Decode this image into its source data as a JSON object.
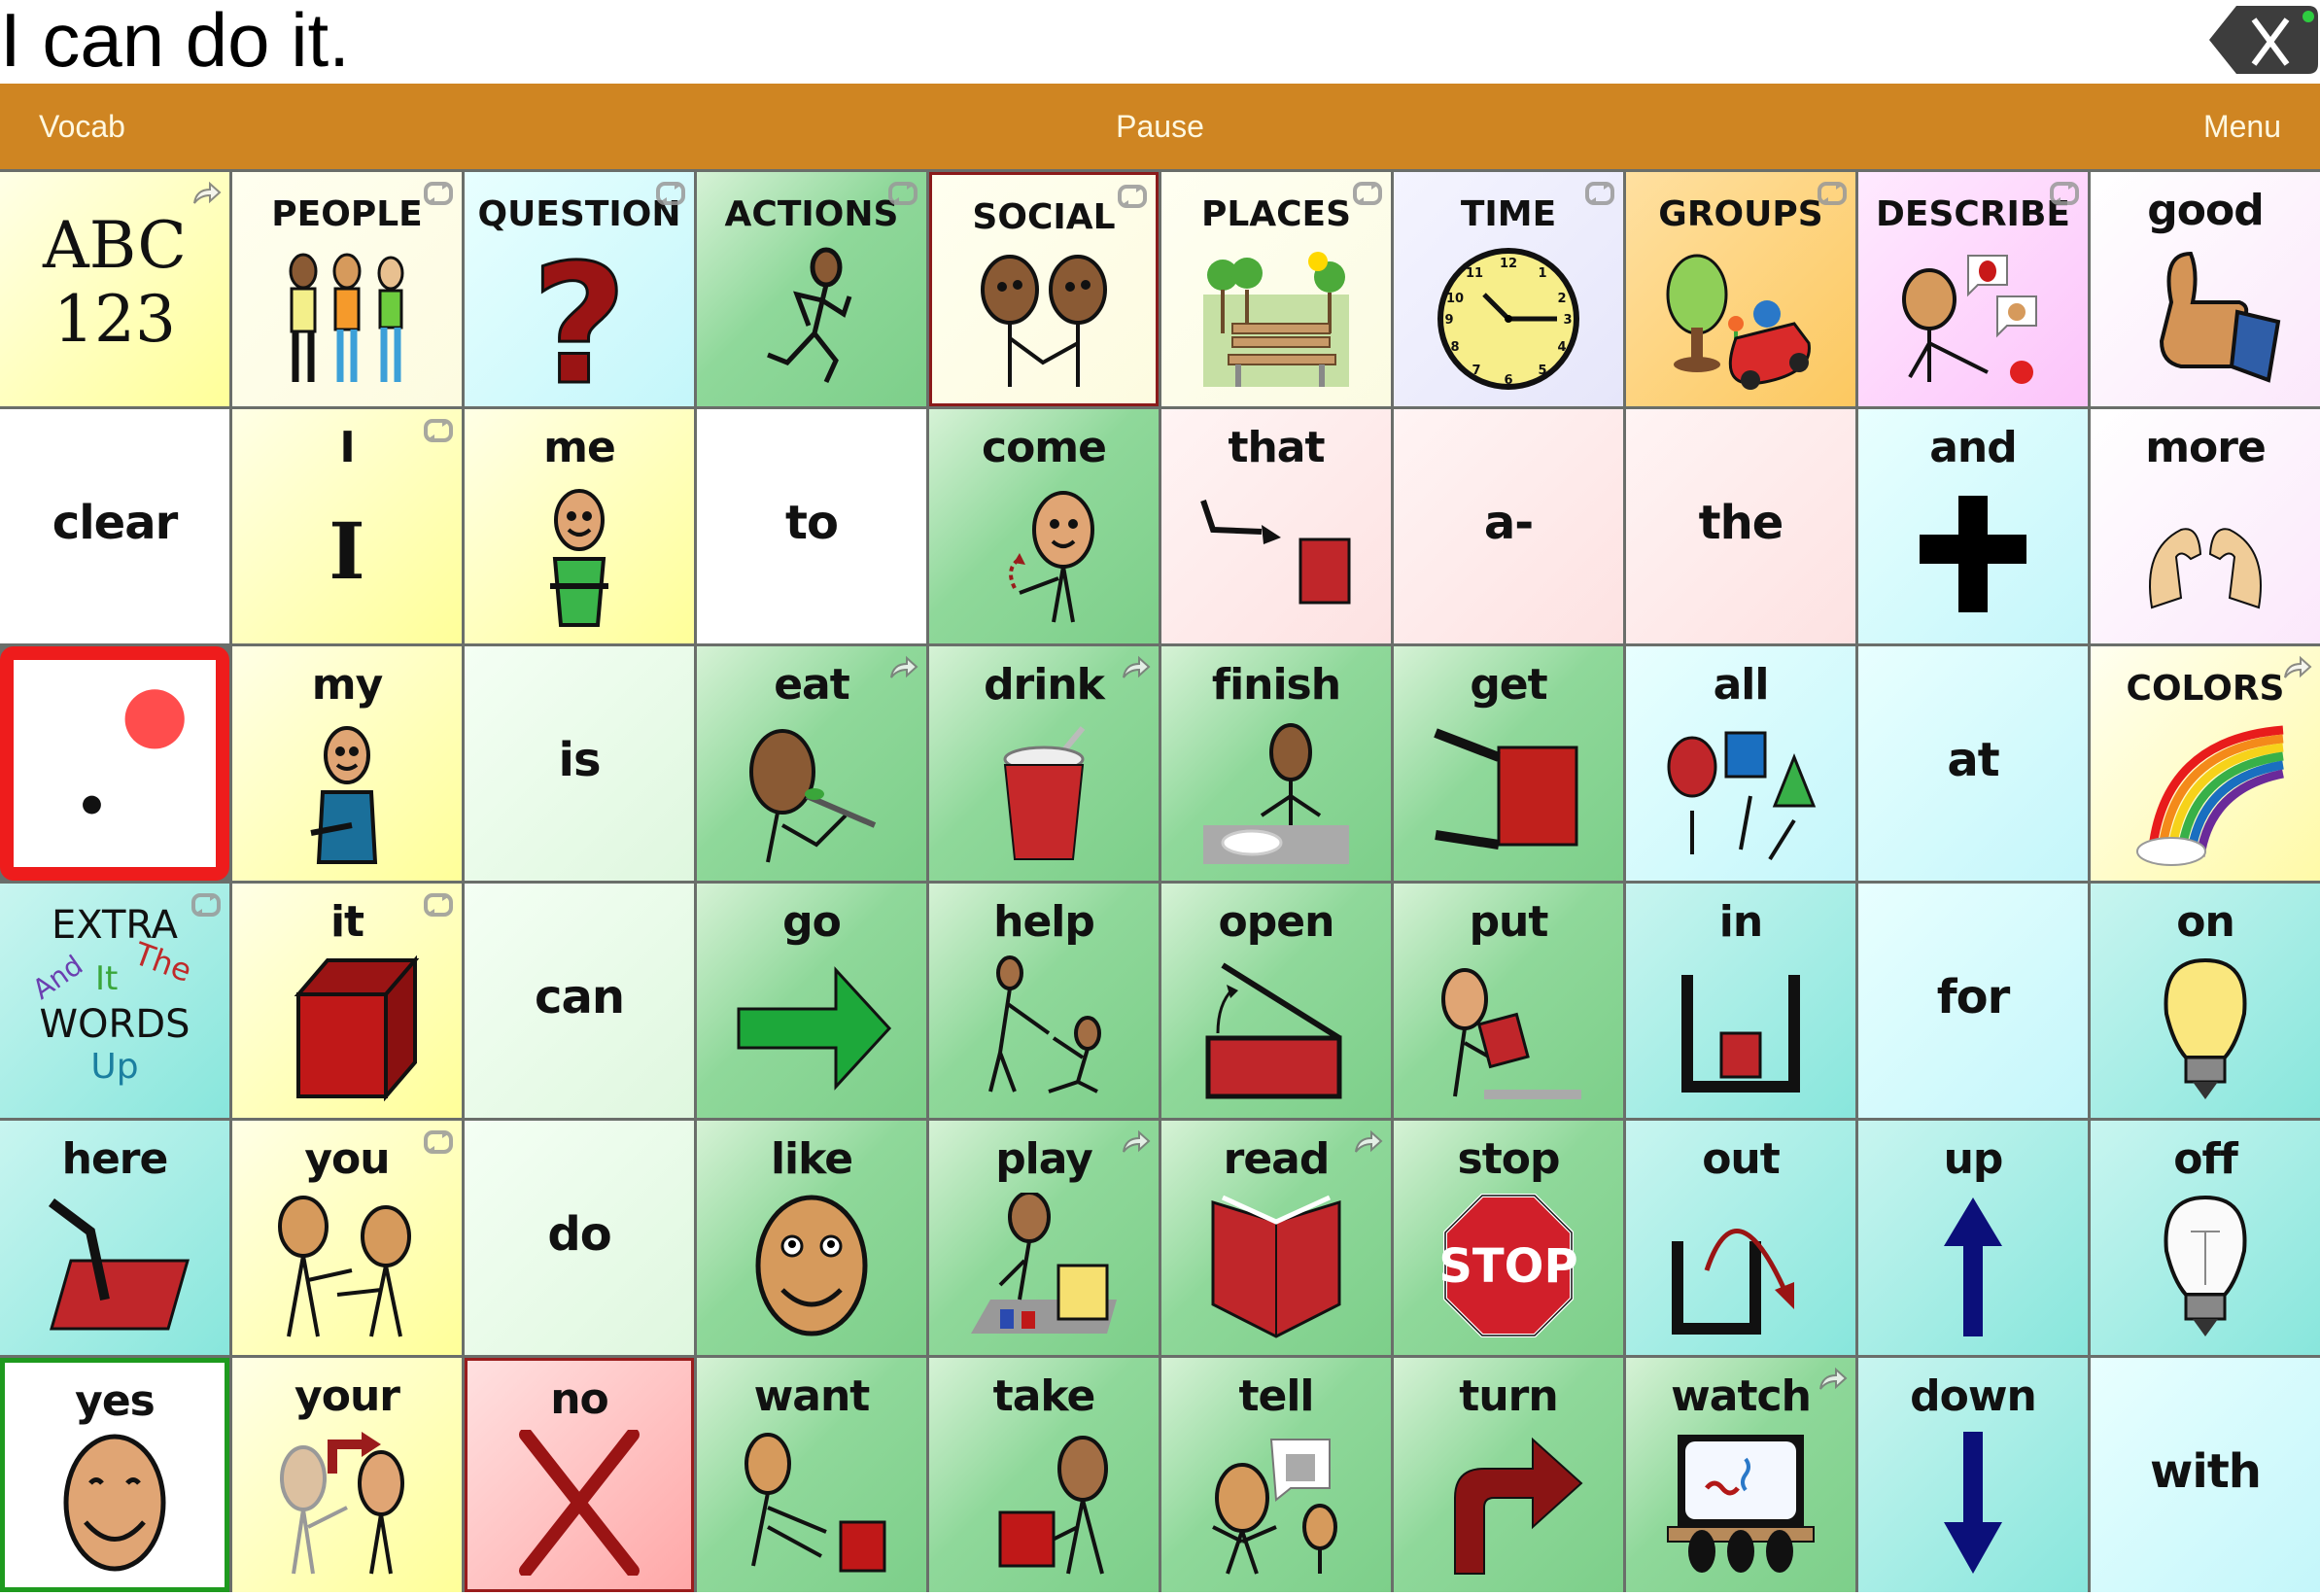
{
  "message_bar": {
    "text": "I can do it.",
    "clear_button": {
      "icon": "backspace-x-icon",
      "label": "X",
      "status_dot_color": "#2ecc40"
    }
  },
  "toolbar": {
    "background": "#CF8522",
    "vocab_label": "Vocab",
    "pause_label": "Pause",
    "menu_label": "Menu"
  },
  "grid": {
    "columns": 10,
    "rows": 6,
    "cells": [
      {
        "label": "ABC\n123",
        "line1": "ABC",
        "line2": "123",
        "color": "yellow",
        "corner": "link-arrow-icon",
        "icon": "alphabet-keyboard-icon"
      },
      {
        "label": "PEOPLE",
        "color": "cream",
        "corner": "swap-icon",
        "icon": "people-icon"
      },
      {
        "label": "QUESTION",
        "color": "cyan",
        "corner": "swap-icon",
        "icon": "question-mark-icon"
      },
      {
        "label": "ACTIONS",
        "color": "green",
        "corner": "swap-icon",
        "icon": "running-person-icon"
      },
      {
        "label": "SOCIAL",
        "color": "cream",
        "corner": "swap-icon",
        "icon": "handshake-icon"
      },
      {
        "label": "PLACES",
        "color": "places",
        "corner": "swap-icon",
        "icon": "park-bench-icon"
      },
      {
        "label": "TIME",
        "color": "lavender-blue",
        "corner": "swap-icon",
        "icon": "clock-icon"
      },
      {
        "label": "GROUPS",
        "color": "orange",
        "corner": "swap-icon",
        "icon": "tree-car-icon"
      },
      {
        "label": "DESCRIBE",
        "color": "pink",
        "corner": "swap-icon",
        "icon": "describe-person-icon"
      },
      {
        "label": "good",
        "color": "lavender",
        "icon": "thumbs-up-icon"
      },
      {
        "label": "clear",
        "color": "white"
      },
      {
        "label": "I",
        "color": "yellow",
        "corner": "swap-icon",
        "icon": "letter-i-icon"
      },
      {
        "label": "me",
        "color": "yellow",
        "icon": "person-self-icon"
      },
      {
        "label": "to",
        "color": "white"
      },
      {
        "label": "come",
        "color": "green",
        "icon": "beckon-person-icon"
      },
      {
        "label": "that",
        "color": "rose",
        "icon": "point-at-box-icon"
      },
      {
        "label": "a-",
        "color": "rose"
      },
      {
        "label": "the",
        "color": "rose"
      },
      {
        "label": "and",
        "color": "cyan",
        "icon": "plus-icon"
      },
      {
        "label": "more",
        "color": "lavender",
        "icon": "more-sign-hands-icon"
      },
      {
        "label": "",
        "color": "white",
        "special": "dot-indicator",
        "icon": "dot-scan-icon"
      },
      {
        "label": "my",
        "color": "yellow",
        "icon": "person-my-icon"
      },
      {
        "label": "is",
        "color": "mint"
      },
      {
        "label": "eat",
        "color": "green",
        "corner": "link-arrow-icon",
        "icon": "eating-person-icon"
      },
      {
        "label": "drink",
        "color": "green",
        "corner": "link-arrow-icon",
        "icon": "cup-straw-icon"
      },
      {
        "label": "finish",
        "color": "green",
        "icon": "finished-plate-icon"
      },
      {
        "label": "get",
        "color": "green",
        "icon": "grab-box-icon"
      },
      {
        "label": "all",
        "color": "cyan",
        "icon": "shapes-all-icon"
      },
      {
        "label": "at",
        "color": "cyan"
      },
      {
        "label": "COLORS",
        "color": "ltyellow",
        "corner": "link-arrow-icon",
        "icon": "rainbow-icon"
      },
      {
        "label": "EXTRA WORDS",
        "color": "teal",
        "corner": "swap-icon",
        "special": "extra-words",
        "extra_words": [
          "And",
          "It",
          "The",
          "Up"
        ],
        "icon": "extra-words-icon"
      },
      {
        "label": "it",
        "color": "yellow",
        "corner": "swap-icon",
        "icon": "red-cube-icon"
      },
      {
        "label": "can",
        "color": "mint"
      },
      {
        "label": "go",
        "color": "green",
        "icon": "green-arrow-right-icon"
      },
      {
        "label": "help",
        "color": "green",
        "icon": "help-person-icon"
      },
      {
        "label": "open",
        "color": "green",
        "icon": "open-box-icon"
      },
      {
        "label": "put",
        "color": "green",
        "icon": "put-down-icon"
      },
      {
        "label": "in",
        "color": "teal",
        "icon": "in-container-icon"
      },
      {
        "label": "for",
        "color": "cyan"
      },
      {
        "label": "on",
        "color": "teal",
        "icon": "lightbulb-on-icon"
      },
      {
        "label": "here",
        "color": "teal",
        "icon": "point-here-icon"
      },
      {
        "label": "you",
        "color": "yellow",
        "corner": "swap-icon",
        "icon": "point-you-icon"
      },
      {
        "label": "do",
        "color": "mint"
      },
      {
        "label": "like",
        "color": "green",
        "icon": "smiley-face-icon"
      },
      {
        "label": "play",
        "color": "green",
        "corner": "link-arrow-icon",
        "icon": "play-toys-icon"
      },
      {
        "label": "read",
        "color": "green",
        "corner": "link-arrow-icon",
        "icon": "open-book-icon"
      },
      {
        "label": "stop",
        "color": "green",
        "icon": "stop-sign-icon"
      },
      {
        "label": "out",
        "color": "teal",
        "icon": "out-container-icon"
      },
      {
        "label": "up",
        "color": "teal",
        "icon": "arrow-up-icon"
      },
      {
        "label": "off",
        "color": "teal",
        "icon": "lightbulb-off-icon"
      },
      {
        "label": "yes",
        "color": "white",
        "icon": "smile-yes-icon"
      },
      {
        "label": "your",
        "color": "yellow",
        "icon": "point-your-icon"
      },
      {
        "label": "no",
        "color": "red",
        "icon": "red-x-icon"
      },
      {
        "label": "want",
        "color": "green",
        "icon": "want-reach-icon"
      },
      {
        "label": "take",
        "color": "green",
        "icon": "take-box-icon"
      },
      {
        "label": "tell",
        "color": "green",
        "icon": "tell-speech-icon"
      },
      {
        "label": "turn",
        "color": "green",
        "icon": "turn-arrow-icon"
      },
      {
        "label": "watch",
        "color": "green",
        "corner": "link-arrow-icon",
        "icon": "watch-screen-icon"
      },
      {
        "label": "down",
        "color": "teal",
        "icon": "arrow-down-icon"
      },
      {
        "label": "with",
        "color": "cyan"
      }
    ]
  }
}
